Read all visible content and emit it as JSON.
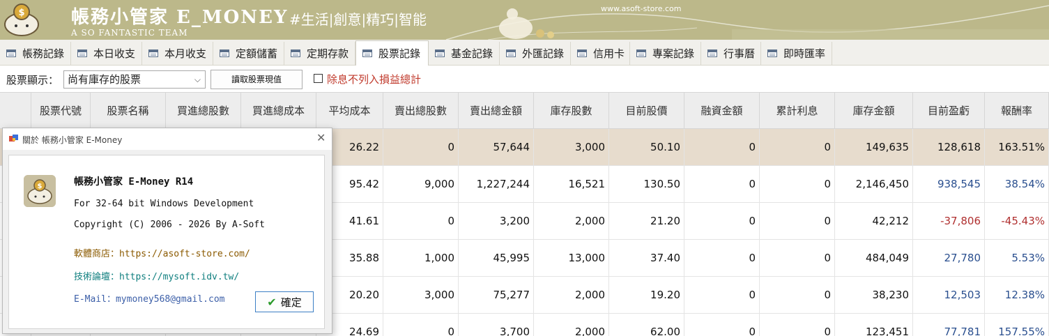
{
  "banner": {
    "title": "帳務小管家 E_MONEY",
    "subtitle": "A SO FANTASTIC TEAM",
    "slogan": "#生活|創意|精巧|智能",
    "website": "www.asoft-store.com",
    "background_color": "#bcb88a"
  },
  "tabs": [
    {
      "label": "帳務記錄",
      "active": false
    },
    {
      "label": "本日收支",
      "active": false
    },
    {
      "label": "本月收支",
      "active": false
    },
    {
      "label": "定額儲蓄",
      "active": false
    },
    {
      "label": "定期存款",
      "active": false
    },
    {
      "label": "股票記錄",
      "active": true
    },
    {
      "label": "基金記錄",
      "active": false
    },
    {
      "label": "外匯記錄",
      "active": false
    },
    {
      "label": "信用卡",
      "active": false
    },
    {
      "label": "專案記錄",
      "active": false
    },
    {
      "label": "行事曆",
      "active": false
    },
    {
      "label": "即時匯率",
      "active": false
    }
  ],
  "toolbar": {
    "display_label": "股票顯示：",
    "display_value": "尚有庫存的股票",
    "fetch_button": "讀取股票現值",
    "exclude_checkbox_label": "除息不列入損益總計",
    "exclude_checked": false
  },
  "grid": {
    "columns": [
      "股票代號",
      "股票名稱",
      "買進總股數",
      "買進總成本",
      "平均成本",
      "賣出總股數",
      "賣出總金額",
      "庫存股數",
      "目前股價",
      "融資金額",
      "累計利息",
      "庫存金額",
      "目前盈虧",
      "報酬率"
    ],
    "rows": [
      {
        "selected": true,
        "cells": [
          "",
          "",
          "",
          "",
          "26.22",
          "0",
          "57,644",
          "3,000",
          "50.10",
          "0",
          "0",
          "149,635",
          "128,618",
          "163.51%"
        ],
        "sign": "zero"
      },
      {
        "selected": false,
        "cells": [
          "",
          "",
          "",
          "",
          "95.42",
          "9,000",
          "1,227,244",
          "16,521",
          "130.50",
          "0",
          "0",
          "2,146,450",
          "938,545",
          "38.54%"
        ],
        "sign": "pos"
      },
      {
        "selected": false,
        "cells": [
          "",
          "",
          "",
          "",
          "41.61",
          "0",
          "3,200",
          "2,000",
          "21.20",
          "0",
          "0",
          "42,212",
          "-37,806",
          "-45.43%"
        ],
        "sign": "neg"
      },
      {
        "selected": false,
        "cells": [
          "",
          "",
          "",
          "",
          "35.88",
          "1,000",
          "45,995",
          "13,000",
          "37.40",
          "0",
          "0",
          "484,049",
          "27,780",
          "5.53%"
        ],
        "sign": "pos"
      },
      {
        "selected": false,
        "cells": [
          "",
          "",
          "",
          "",
          "20.20",
          "3,000",
          "75,277",
          "2,000",
          "19.20",
          "0",
          "0",
          "38,230",
          "12,503",
          "12.38%"
        ],
        "sign": "pos"
      },
      {
        "selected": false,
        "cells": [
          "",
          "",
          "",
          "",
          "24.69",
          "0",
          "3,700",
          "2,000",
          "62.00",
          "0",
          "0",
          "123,451",
          "77,781",
          "157.55%"
        ],
        "sign": "pos"
      }
    ],
    "selected_row_color": "#e7dccd",
    "positive_color": "#2a4f8f",
    "negative_color": "#b03030"
  },
  "about_dialog": {
    "window_title": "關於 帳務小管家 E-Money",
    "product": "帳務小管家 E-Money R14",
    "platform": "For 32-64 bit Windows Development",
    "copyright": "Copyright (C) 2006 - 2026 By A-Soft",
    "store": "軟體商店：https://asoft-store.com/",
    "forum": "技術論壇：https://mysoft.idv.tw/",
    "email": "E-Mail：mymoney568@gmail.com",
    "ok_button": "確定"
  }
}
